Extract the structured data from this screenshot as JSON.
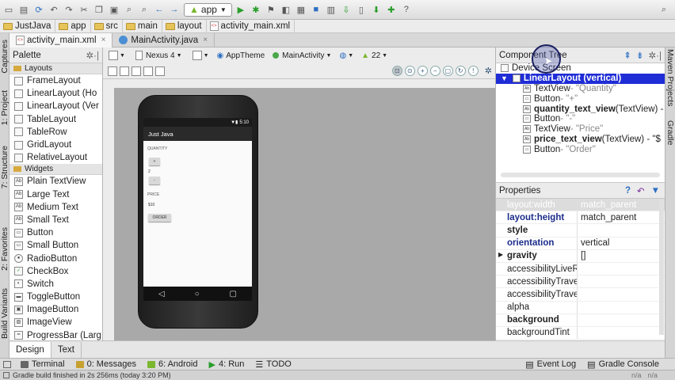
{
  "breadcrumb": [
    "JustJava",
    "app",
    "src",
    "main",
    "layout",
    "activity_main.xml"
  ],
  "toolbar": {
    "run_config": "app"
  },
  "editor_tabs": [
    {
      "label": "activity_main.xml",
      "active": true
    },
    {
      "label": "MainActivity.java",
      "active": false
    }
  ],
  "left_stripe": [
    "Captures",
    "1: Project",
    "7: Structure",
    "2: Favorites",
    "Build Variants"
  ],
  "right_stripe": [
    "Maven Projects",
    "Gradle"
  ],
  "palette": {
    "title": "Palette",
    "groups": [
      {
        "name": "Layouts",
        "items": [
          "FrameLayout",
          "LinearLayout (Ho",
          "LinearLayout (Ver",
          "TableLayout",
          "TableRow",
          "GridLayout",
          "RelativeLayout"
        ]
      },
      {
        "name": "Widgets",
        "items": [
          "Plain TextView",
          "Large Text",
          "Medium Text",
          "Small Text",
          "Button",
          "Small Button",
          "RadioButton",
          "CheckBox",
          "Switch",
          "ToggleButton",
          "ImageButton",
          "ImageView",
          "ProgressBar (Larg"
        ]
      }
    ]
  },
  "design_toolbar": {
    "device": "Nexus 4",
    "theme": "AppTheme",
    "activity": "MainActivity",
    "api": "22"
  },
  "device_preview": {
    "status_time": "5:10",
    "app_title": "Just Java",
    "quantity_label": "QUANTITY",
    "plus": "+",
    "quantity_value": "2",
    "minus": "-",
    "price_label": "PRICE",
    "price_value": "$10",
    "order_button": "ORDER"
  },
  "bottom_tabs": [
    {
      "label": "Design",
      "active": true
    },
    {
      "label": "Text",
      "active": false
    }
  ],
  "component_tree": {
    "title": "Component Tree",
    "device": "Device Screen",
    "root": "LinearLayout (vertical)",
    "children": [
      {
        "name": "TextView",
        "detail": " - \"Quantity\"",
        "bold": false
      },
      {
        "name": "Button",
        "detail": " - \"+\"",
        "bold": false
      },
      {
        "name": "quantity_text_view",
        "suffix": " (TextView) -",
        "bold": true
      },
      {
        "name": "Button",
        "detail": " - \"-\"",
        "bold": false
      },
      {
        "name": "TextView",
        "detail": " - \"Price\"",
        "bold": false
      },
      {
        "name": "price_text_view",
        "suffix": " (TextView) - \"$",
        "bold": true
      },
      {
        "name": "Button",
        "detail": " - \"Order\"",
        "bold": false
      }
    ]
  },
  "properties": {
    "title": "Properties",
    "rows": [
      {
        "name": "layout:width",
        "value": "match_parent",
        "style": "sel"
      },
      {
        "name": "layout:height",
        "value": "match_parent",
        "style": "navy"
      },
      {
        "name": "style",
        "value": "",
        "style": "b"
      },
      {
        "name": "orientation",
        "value": "vertical",
        "style": "navy"
      },
      {
        "name": "gravity",
        "value": "[]",
        "style": "b"
      },
      {
        "name": "accessibilityLiveR",
        "value": "",
        "style": ""
      },
      {
        "name": "accessibilityTrave",
        "value": "",
        "style": ""
      },
      {
        "name": "accessibilityTrave",
        "value": "",
        "style": ""
      },
      {
        "name": "alpha",
        "value": "",
        "style": ""
      },
      {
        "name": "background",
        "value": "",
        "style": "b"
      },
      {
        "name": "backgroundTint",
        "value": "",
        "style": ""
      }
    ]
  },
  "tool_windows": [
    {
      "label": "Terminal"
    },
    {
      "label": "0: Messages"
    },
    {
      "label": "6: Android"
    },
    {
      "label": "4: Run"
    },
    {
      "label": "TODO"
    }
  ],
  "tool_windows_right": [
    {
      "label": "Event Log"
    },
    {
      "label": "Gradle Console"
    }
  ],
  "status_message": "Gradle build finished in 2s 256ms (today 3:20 PM)",
  "status_right": [
    "n/a",
    "n/a"
  ]
}
